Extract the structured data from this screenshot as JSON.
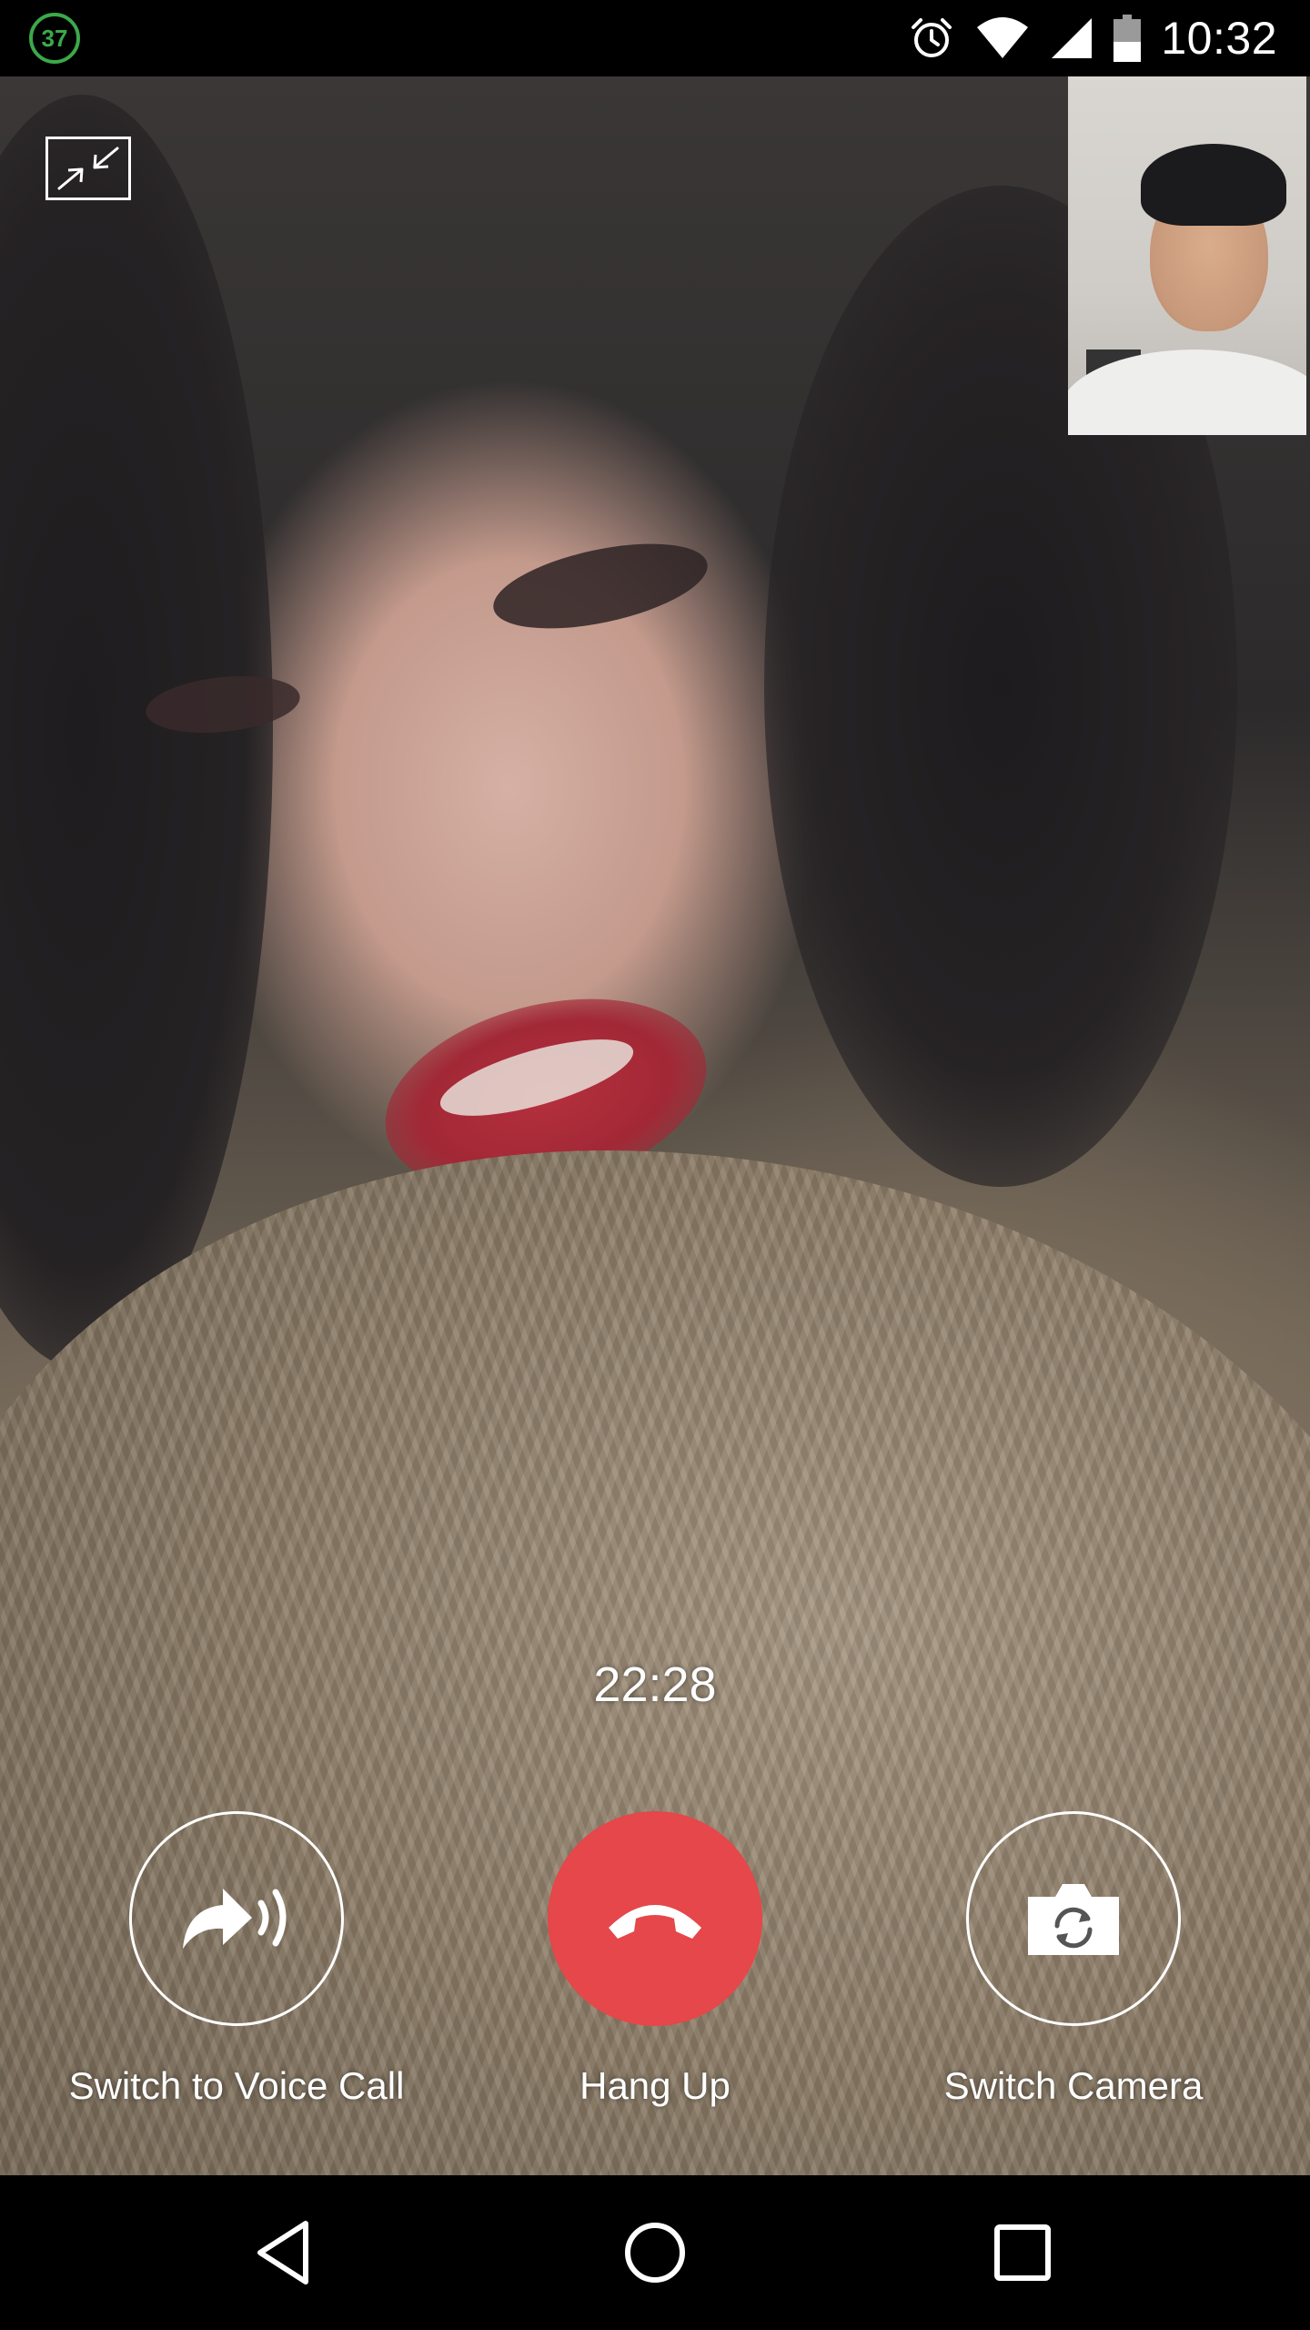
{
  "status_bar": {
    "notification_count": "37",
    "time": "10:32",
    "icons": [
      "alarm-icon",
      "wifi-icon",
      "signal-icon",
      "battery-icon"
    ]
  },
  "video": {
    "minimize_icon": "minimize-icon"
  },
  "call": {
    "timer": "22:28",
    "controls": [
      {
        "label": "Switch to Voice Call",
        "icon": "voice-call-icon"
      },
      {
        "label": "Hang Up",
        "icon": "hang-up-icon"
      },
      {
        "label": "Switch Camera",
        "icon": "switch-camera-icon"
      }
    ]
  },
  "nav_bar": {
    "icons": [
      "back-icon",
      "home-icon",
      "recents-icon"
    ]
  },
  "colors": {
    "hang_up": "#e5474a",
    "badge": "#3ba94a"
  }
}
